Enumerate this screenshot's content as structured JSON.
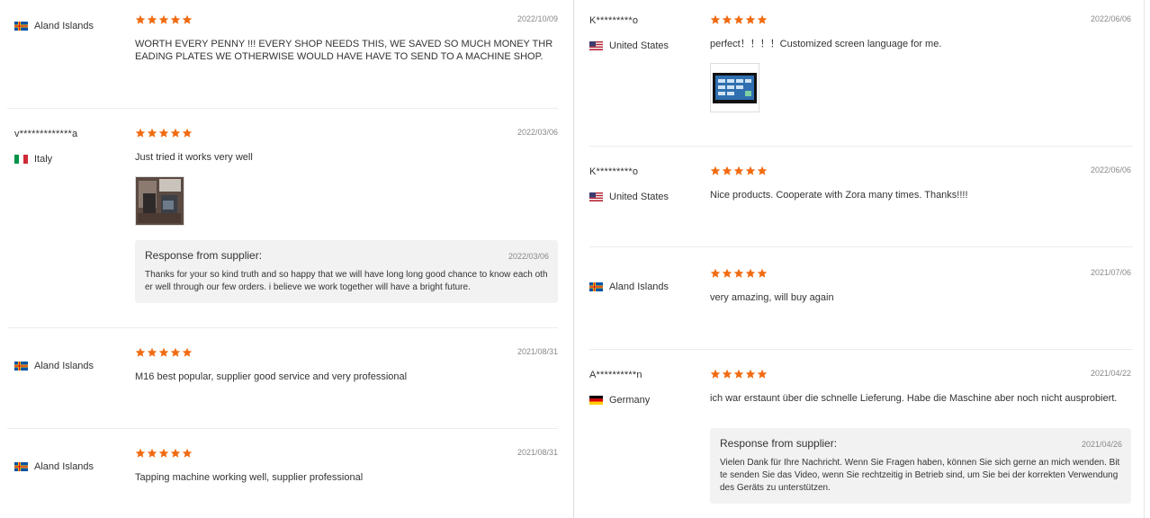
{
  "response_title": "Response from supplier:",
  "colors": {
    "star": "#f16b11",
    "divider": "#dcdcdc",
    "response_bg": "#f2f2f2"
  },
  "left_reviews": [
    {
      "username": "",
      "country": "Aland Islands",
      "flag": "aland-flag-icon",
      "rating": 5,
      "date": "2022/10/09",
      "text": "WORTH EVERY PENNY !!! EVERY SHOP NEEDS THIS, WE SAVED SO MUCH MONEY THREADING PLATES WE OTHERWISE WOULD HAVE HAVE TO SEND TO A MACHINE SHOP."
    },
    {
      "username": "v*************a",
      "country": "Italy",
      "flag": "italy-flag-icon",
      "rating": 5,
      "date": "2022/03/06",
      "text": "Just tried it works very well",
      "response_date": "2022/03/06",
      "response_text": "Thanks for your so kind truth and so happy that we will have long long good chance to know each other well through our few orders. i believe we work together will have a bright future."
    },
    {
      "username": "",
      "country": "Aland Islands",
      "flag": "aland-flag-icon",
      "rating": 5,
      "date": "2021/08/31",
      "text": "M16 best popular, supplier good service and very professional"
    },
    {
      "username": "",
      "country": "Aland Islands",
      "flag": "aland-flag-icon",
      "rating": 5,
      "date": "2021/08/31",
      "text": "Tapping machine working well, supplier professional"
    }
  ],
  "right_reviews": [
    {
      "username": "K*********o",
      "country": "United States",
      "flag": "us-flag-icon",
      "rating": 5,
      "date": "2022/06/06",
      "text": "perfect！！！！Customized screen language for me."
    },
    {
      "username": "K*********o",
      "country": "United States",
      "flag": "us-flag-icon",
      "rating": 5,
      "date": "2022/06/06",
      "text": "Nice products. Cooperate with Zora many times. Thanks!!!!"
    },
    {
      "username": "",
      "country": "Aland Islands",
      "flag": "aland-flag-icon",
      "rating": 5,
      "date": "2021/07/06",
      "text": "very amazing, will buy again"
    },
    {
      "username": "A**********n",
      "country": "Germany",
      "flag": "germany-flag-icon",
      "rating": 5,
      "date": "2021/04/22",
      "text": "ich war erstaunt über die schnelle Lieferung. Habe die Maschine aber noch nicht ausprobiert.",
      "response_date": "2021/04/26",
      "response_text": "Vielen Dank für Ihre Nachricht. Wenn Sie Fragen haben, können Sie sich gerne an mich wenden. Bitte senden Sie das Video, wenn Sie rechtzeitig in Betrieb sind, um Sie bei der korrekten Verwendung des Geräts zu unterstützen."
    }
  ]
}
